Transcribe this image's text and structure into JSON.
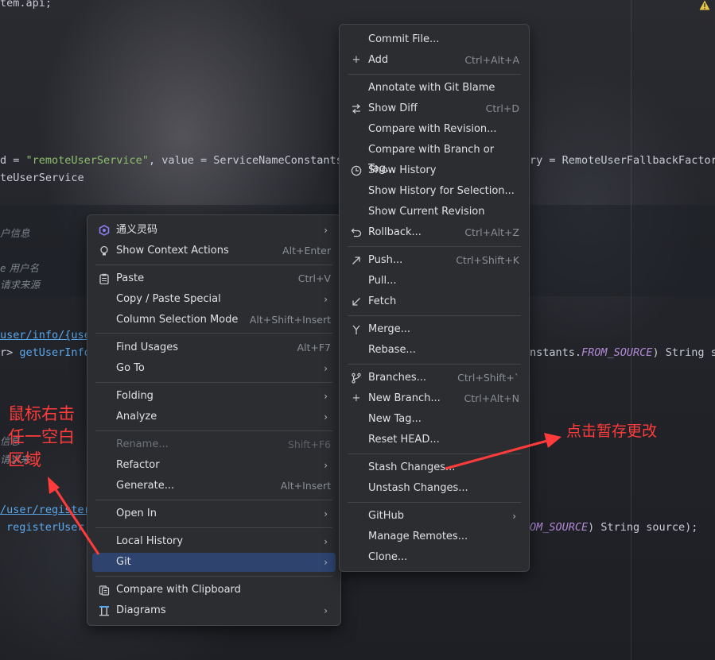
{
  "editor": {
    "lines": {
      "l1": "tem.api;",
      "l2_pre": "d = ",
      "l2_str": "\"remoteUserService\"",
      "l2_post": ", value = ServiceNameConstants",
      "l2_right": "ry = RemoteUserFallbackFactory",
      "l3": "teUserService",
      "cm1": "户信息",
      "cm2_pre": "e",
      "cm2": "用户名",
      "cm3": "请求来源",
      "route1": "user/info/{user",
      "l5_pre": "r> ",
      "l5_fn": "getUserInfo",
      "l5_right_pre": "nstants.",
      "l5_right_it": "FROM_SOURCE",
      "l5_right_post": ") String so",
      "cm4": "信息",
      "cm5": "请求来",
      "route2": "/user/register",
      "l7_fn": "registerUser",
      "l7_right_it": "OM_SOURCE",
      "l7_right_post": ") String source);"
    },
    "warning_icon": "warning-triangle-icon"
  },
  "context_menu": {
    "items": [
      {
        "label": "通义灵码",
        "icon": "tongyi-lingma-icon",
        "submenu": true
      },
      {
        "label": "Show Context Actions",
        "icon": "lightbulb-icon",
        "shortcut": "Alt+Enter"
      },
      {
        "label": "Paste",
        "icon": "clipboard-icon",
        "shortcut": "Ctrl+V"
      },
      {
        "label": "Copy / Paste Special",
        "submenu": true
      },
      {
        "label": "Column Selection Mode",
        "shortcut": "Alt+Shift+Insert"
      },
      {
        "label": "Find Usages",
        "shortcut": "Alt+F7"
      },
      {
        "label": "Go To",
        "submenu": true
      },
      {
        "label": "Folding",
        "submenu": true
      },
      {
        "label": "Analyze",
        "submenu": true
      },
      {
        "label": "Rename...",
        "shortcut": "Shift+F6",
        "disabled": true
      },
      {
        "label": "Refactor",
        "submenu": true
      },
      {
        "label": "Generate...",
        "shortcut": "Alt+Insert"
      },
      {
        "label": "Open In",
        "submenu": true
      },
      {
        "label": "Local History",
        "submenu": true
      },
      {
        "label": "Git",
        "submenu": true,
        "selected": true
      },
      {
        "label": "Compare with Clipboard",
        "icon": "compare-clipboard-icon"
      },
      {
        "label": "Diagrams",
        "icon": "diagram-icon",
        "submenu": true
      }
    ]
  },
  "git_menu": {
    "items": [
      {
        "label": "Commit File..."
      },
      {
        "label": "Add",
        "icon": "plus-icon",
        "shortcut": "Ctrl+Alt+A"
      },
      {
        "label": "Annotate with Git Blame"
      },
      {
        "label": "Show Diff",
        "icon": "diff-icon",
        "shortcut": "Ctrl+D"
      },
      {
        "label": "Compare with Revision..."
      },
      {
        "label": "Compare with Branch or Tag..."
      },
      {
        "label": "Show History",
        "icon": "history-clock-icon"
      },
      {
        "label": "Show History for Selection..."
      },
      {
        "label": "Show Current Revision"
      },
      {
        "label": "Rollback...",
        "icon": "rollback-icon",
        "shortcut": "Ctrl+Alt+Z"
      },
      {
        "label": "Push...",
        "icon": "push-arrow-icon",
        "shortcut": "Ctrl+Shift+K"
      },
      {
        "label": "Pull..."
      },
      {
        "label": "Fetch",
        "icon": "fetch-arrow-icon"
      },
      {
        "label": "Merge...",
        "icon": "merge-icon"
      },
      {
        "label": "Rebase..."
      },
      {
        "label": "Branches...",
        "icon": "branch-icon",
        "shortcut": "Ctrl+Shift+`"
      },
      {
        "label": "New Branch...",
        "icon": "plus-icon",
        "shortcut": "Ctrl+Alt+N"
      },
      {
        "label": "New Tag..."
      },
      {
        "label": "Reset HEAD..."
      },
      {
        "label": "Stash Changes..."
      },
      {
        "label": "Unstash Changes..."
      },
      {
        "label": "GitHub",
        "submenu": true
      },
      {
        "label": "Manage Remotes..."
      },
      {
        "label": "Clone..."
      }
    ]
  },
  "annotations": {
    "left_note": [
      "鼠标右击",
      "任一空白",
      "区域"
    ],
    "right_note": "点击暂存更改",
    "color": "#ff3b3b"
  },
  "colors": {
    "menu_bg": "#2b2d30",
    "selected": "#2e436e",
    "string": "#8fbf6d",
    "function": "#5aa8ec",
    "constant": "#b38ad6"
  }
}
